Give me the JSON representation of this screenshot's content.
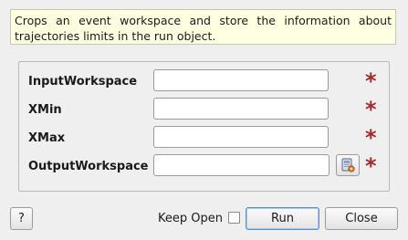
{
  "description": "Crops an event workspace and store the information about trajectories limits in the run object.",
  "params": [
    {
      "label": "InputWorkspace",
      "value": ""
    },
    {
      "label": "XMin",
      "value": ""
    },
    {
      "label": "XMax",
      "value": ""
    },
    {
      "label": "OutputWorkspace",
      "value": ""
    }
  ],
  "required_marker": "*",
  "footer": {
    "help_label": "?",
    "keep_open_label": "Keep Open",
    "keep_open_checked": false,
    "run_label": "Run",
    "close_label": "Close"
  },
  "colors": {
    "description_bg": "#ffffe1",
    "required_star": "#a52a2a"
  },
  "icons": {
    "browse": "workspace-save-icon"
  }
}
